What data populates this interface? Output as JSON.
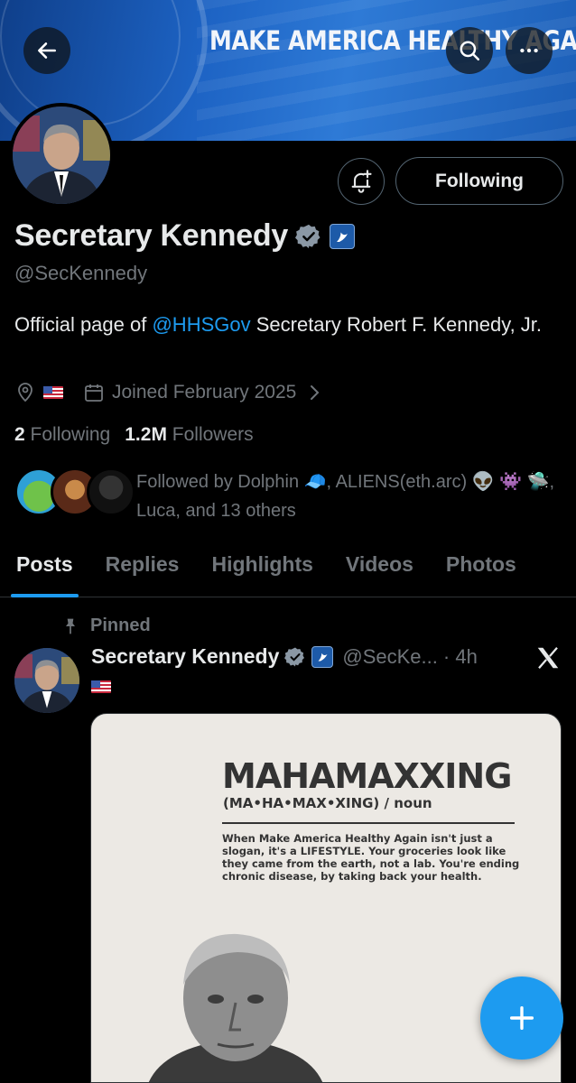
{
  "banner": {
    "title": "MAKE AMERICA HEALTHY AGAIN"
  },
  "header": {
    "back_icon": "arrow-left-icon",
    "search_icon": "search-icon",
    "more_icon": "more-dots-icon"
  },
  "profile": {
    "name": "Secretary Kennedy",
    "handle": "@SecKennedy",
    "bio_prefix": "Official page of ",
    "bio_mention": "@HHSGov",
    "bio_suffix": " Secretary Robert F. Kennedy, Jr.",
    "joined": "Joined February 2025",
    "following_count": "2",
    "following_label": "Following",
    "followers_count": "1.2M",
    "followers_label": "Followers",
    "followed_by": "Followed by Dolphin 🧢, ALIENS(eth.arc) 👽 👾 🛸, Luca, and 13 others",
    "follow_button": "Following"
  },
  "tabs": [
    {
      "label": "Posts",
      "active": true
    },
    {
      "label": "Replies",
      "active": false
    },
    {
      "label": "Highlights",
      "active": false
    },
    {
      "label": "Videos",
      "active": false
    },
    {
      "label": "Photos",
      "active": false
    }
  ],
  "post": {
    "pinned_label": "Pinned",
    "author": "Secretary Kennedy",
    "handle": "@SecKe...",
    "time": "· 4h",
    "media": {
      "title": "MAHAMAXXING",
      "pronunciation": "(MA•HA•MAX•XING) / noun",
      "definition": "When Make America Healthy Again isn't just a slogan, it's a LIFESTYLE. Your groceries look like they came from the earth, not a lab. You're ending chronic disease, by taking back your health."
    }
  },
  "colors": {
    "accent": "#1d9bf0",
    "muted": "#71767b",
    "text": "#e7e9ea",
    "background": "#000000"
  }
}
